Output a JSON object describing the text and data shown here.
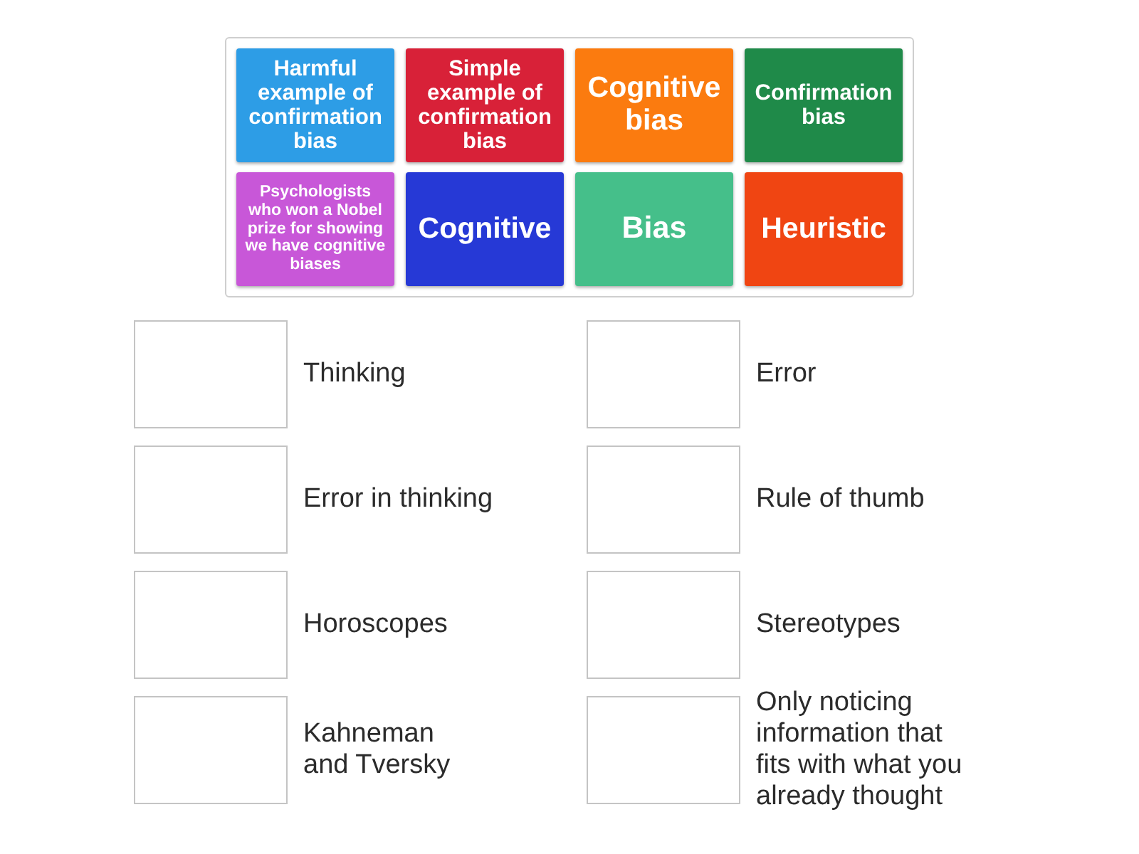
{
  "tiles": [
    {
      "label": "Harmful example of confirmation bias",
      "color": "#2d9de6"
    },
    {
      "label": "Simple example of confirmation bias",
      "color": "#d82138"
    },
    {
      "label": "Cognitive bias",
      "color": "#fb7b0f"
    },
    {
      "label": "Confirmation bias",
      "color": "#1f8a49"
    },
    {
      "label": "Psychologists who won a Nobel prize for showing we have cognitive biases",
      "color": "#c857d8"
    },
    {
      "label": "Cognitive",
      "color": "#2639d6"
    },
    {
      "label": "Bias",
      "color": "#45bf8a"
    },
    {
      "label": "Heuristic",
      "color": "#f04512"
    }
  ],
  "targets": [
    {
      "label": "Thinking"
    },
    {
      "label": "Error in thinking"
    },
    {
      "label": "Horoscopes"
    },
    {
      "label": "Kahneman\nand Tversky"
    },
    {
      "label": "Error"
    },
    {
      "label": "Rule of thumb"
    },
    {
      "label": "Stereotypes"
    },
    {
      "label": "Only noticing information that fits with what you already thought"
    }
  ]
}
